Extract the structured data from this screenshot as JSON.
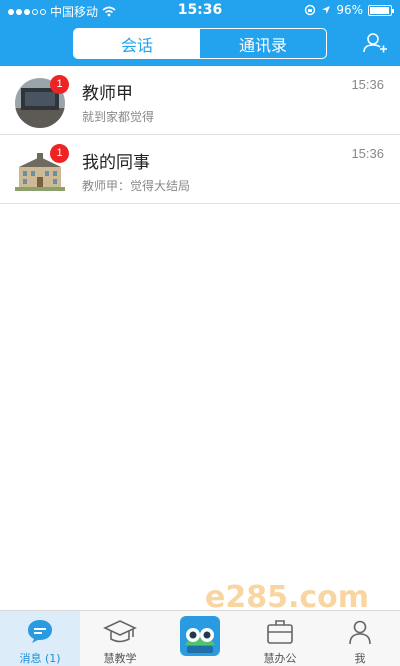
{
  "status_bar": {
    "carrier": "中国移动",
    "time": "15:36",
    "battery_text": "96%",
    "battery_level": 0.96
  },
  "header": {
    "tabs": [
      {
        "label": "会话",
        "active": true
      },
      {
        "label": "通讯录",
        "active": false
      }
    ],
    "add_icon": "add-contact-icon"
  },
  "conversations": [
    {
      "title": "教师甲",
      "subtitle": "就到家都觉得",
      "time": "15:36",
      "unread": "1"
    },
    {
      "title": "我的同事",
      "subtitle": "教师甲：觉得大结局",
      "time": "15:36",
      "unread": "1"
    }
  ],
  "tabbar": {
    "items": [
      {
        "label": "消息 (1)",
        "icon": "chat-bubble-icon",
        "active": true
      },
      {
        "label": "慧教学",
        "icon": "graduation-cap-icon",
        "active": false
      },
      {
        "label": "",
        "icon": "app-logo-icon",
        "active": false
      },
      {
        "label": "慧办公",
        "icon": "briefcase-icon",
        "active": false
      },
      {
        "label": "我",
        "icon": "person-icon",
        "active": false
      }
    ]
  },
  "watermark": "e285.com",
  "colors": {
    "header": "#23a3ee",
    "badge": "#ee2424",
    "active_tab": "#1b8fd8"
  }
}
